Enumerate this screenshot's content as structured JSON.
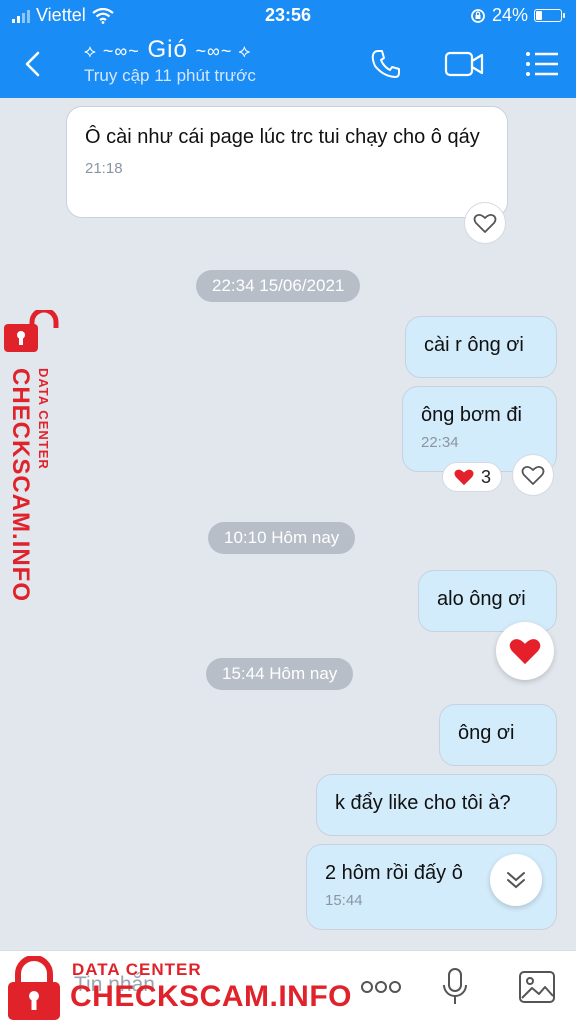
{
  "status_bar": {
    "carrier": "Viettel",
    "time": "23:56",
    "battery_text": "24%",
    "battery_level": 0.24
  },
  "header": {
    "name": "Gió",
    "last_seen": "Truy cập 11 phút trước"
  },
  "messages": [
    {
      "text": "Ô cài như cái page lúc trc tui chạy cho ô qáy",
      "time": "21:18"
    },
    {
      "date": "22:34 15/06/2021"
    },
    {
      "text": "cài r ông ơi"
    },
    {
      "text": "ông bơm đi",
      "time": "22:34",
      "reaction_count": "3"
    },
    {
      "date": "10:10 Hôm nay"
    },
    {
      "text": "alo ông ơi"
    },
    {
      "date": "15:44 Hôm nay"
    },
    {
      "text": "ông ơi"
    },
    {
      "text": "k đẩy like cho tôi à?"
    },
    {
      "text": "2 hôm rồi đấy ô",
      "time": "15:44"
    }
  ],
  "input": {
    "placeholder": "Tin nhắn"
  },
  "watermark": {
    "line1": "DATA CENTER",
    "line2": "CHECKSCAM.INFO"
  },
  "colors": {
    "header": "#1a8cf5",
    "outgoing": "#d3ecfb",
    "incoming": "#ffffff",
    "chat_bg": "#e2e7ee",
    "watermark": "#e0232b"
  },
  "icons": [
    "back-icon",
    "phone-icon",
    "video-icon",
    "menu-icon",
    "heart-icon",
    "chevron-down-icon",
    "more-icon",
    "microphone-icon",
    "image-icon",
    "lock-icon"
  ]
}
